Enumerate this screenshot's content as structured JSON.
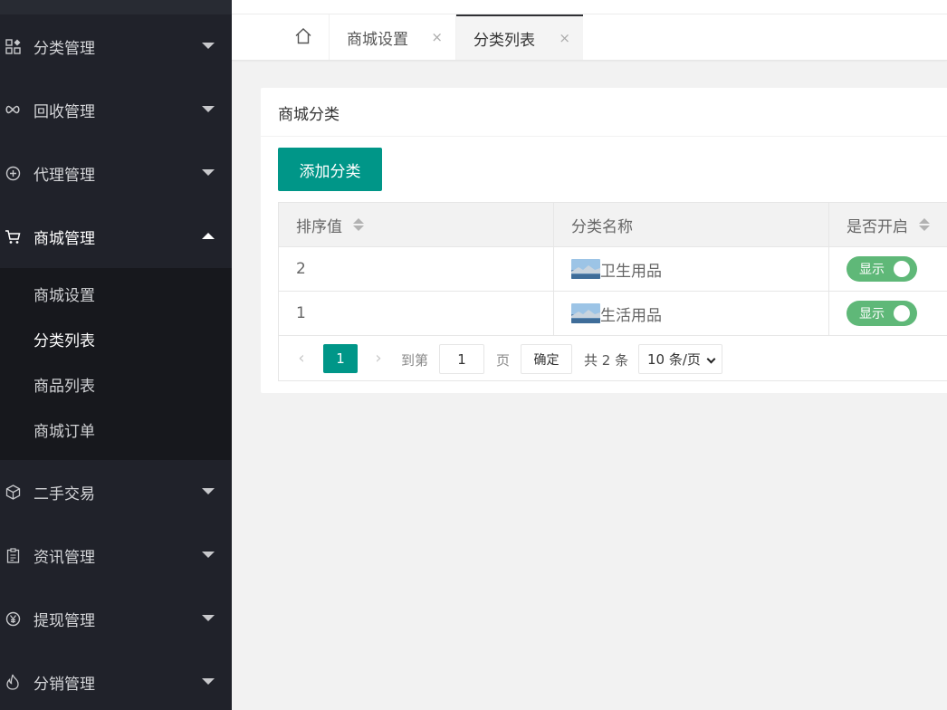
{
  "sidebar": {
    "menu": [
      {
        "label": "分类管理",
        "icon": "grid-icon"
      },
      {
        "label": "回收管理",
        "icon": "infinity-icon"
      },
      {
        "label": "代理管理",
        "icon": "plus-circle-icon"
      },
      {
        "label": "商城管理",
        "icon": "cart-icon"
      },
      {
        "label": "二手交易",
        "icon": "cube-icon"
      },
      {
        "label": "资讯管理",
        "icon": "clipboard-icon"
      },
      {
        "label": "提现管理",
        "icon": "yen-circle-icon"
      },
      {
        "label": "分销管理",
        "icon": "fire-icon"
      }
    ],
    "submenu": [
      {
        "label": "商城设置"
      },
      {
        "label": "分类列表"
      },
      {
        "label": "商品列表"
      },
      {
        "label": "商城订单"
      }
    ]
  },
  "tabs": [
    {
      "label": "商城设置",
      "close": "×"
    },
    {
      "label": "分类列表",
      "close": "×"
    }
  ],
  "card": {
    "title": "商城分类",
    "add_button": "添加分类"
  },
  "table": {
    "headers": [
      "排序值",
      "分类名称",
      "是否开启"
    ],
    "rows": [
      {
        "sort": "2",
        "name": "卫生用品",
        "status": "显示"
      },
      {
        "sort": "1",
        "name": "生活用品",
        "status": "显示"
      }
    ]
  },
  "pagination": {
    "prev": "‹",
    "next": "›",
    "current": "1",
    "goto_label": "到第",
    "goto_value": "1",
    "page_label": "页",
    "confirm": "确定",
    "total": "共 2 条",
    "page_size": "10 条/页"
  },
  "colors": {
    "primary": "#009688",
    "switch_on": "#5fb878",
    "sidebar_bg": "#20222a"
  }
}
